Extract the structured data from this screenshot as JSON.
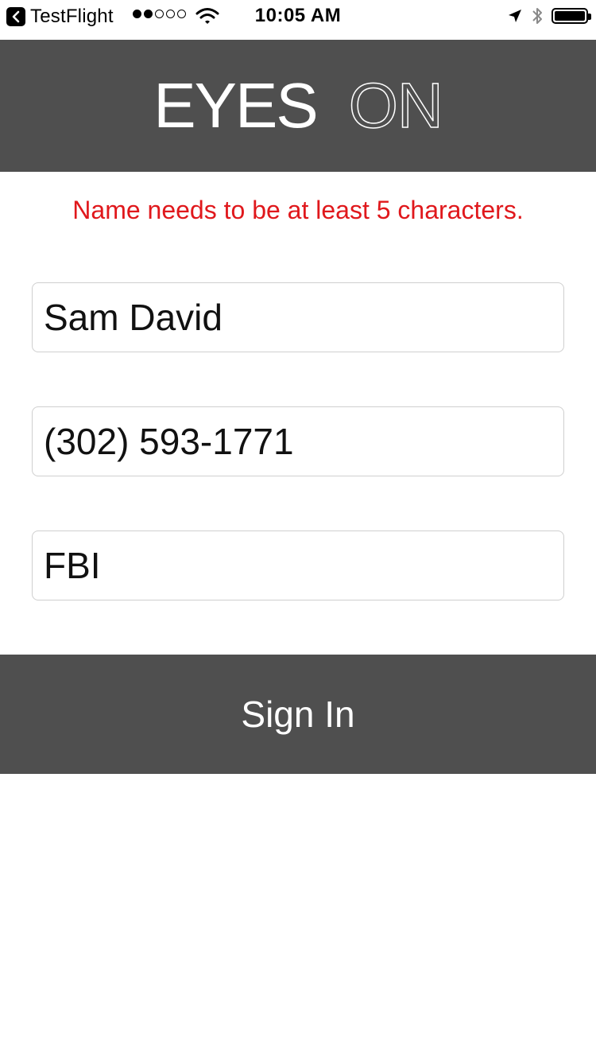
{
  "status_bar": {
    "back_app_label": "TestFlight",
    "signal_dots_filled": 2,
    "signal_dots_total": 5,
    "time": "10:05 AM",
    "icons": [
      "back-chevron-icon",
      "wifi-icon",
      "location-arrow-icon",
      "bluetooth-icon",
      "battery-icon"
    ],
    "battery_level": 1.0
  },
  "header": {
    "title_part1": "EYES",
    "title_part2": "ON",
    "background_color": "#4f4f4f"
  },
  "form": {
    "error_message": "Name needs to be at least 5 characters.",
    "error_color": "#e0181c",
    "name_value": "Sam David",
    "phone_value": "(302) 593-1771",
    "agency_value": "FBI"
  },
  "actions": {
    "sign_in_label": "Sign In"
  }
}
